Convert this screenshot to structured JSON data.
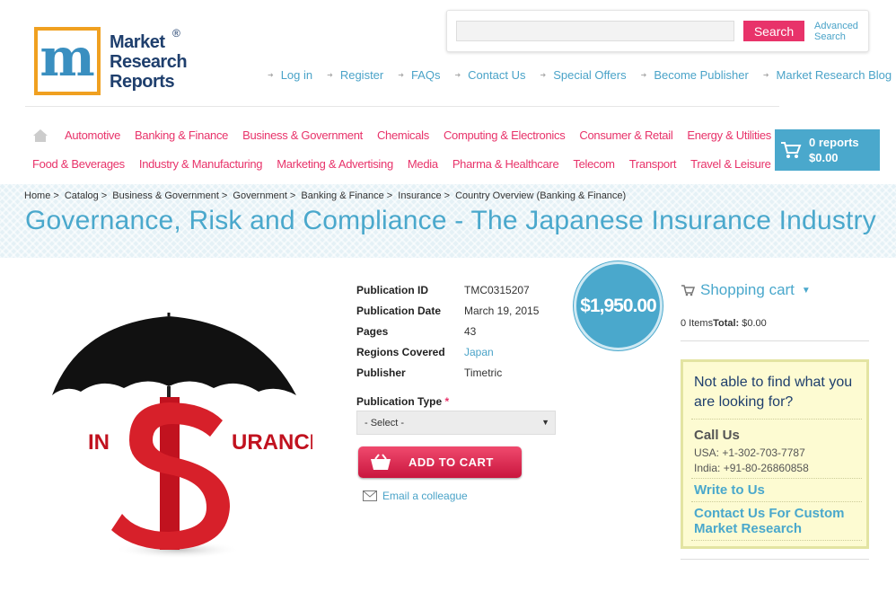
{
  "logo": {
    "letter": "m",
    "line1": "Market",
    "line2": "Research",
    "line3": "Reports",
    "reg": "®"
  },
  "search": {
    "placeholder": "",
    "button": "Search",
    "advanced_line1": "Advanced",
    "advanced_line2": "Search"
  },
  "top_links": [
    "Log in",
    "Register",
    "FAQs",
    "Contact Us",
    "Special Offers",
    "Become Publisher",
    "Market Research Blog"
  ],
  "categories_row1": [
    "Automotive",
    "Banking & Finance",
    "Business & Government",
    "Chemicals",
    "Computing & Electronics",
    "Consumer & Retail",
    "Energy & Utilities"
  ],
  "categories_row2": [
    "Food & Beverages",
    "Industry & Manufacturing",
    "Marketing & Advertising",
    "Media",
    "Pharma & Healthcare",
    "Telecom",
    "Transport",
    "Travel & Leisure"
  ],
  "cart": {
    "reports": "0 reports",
    "total": "$0.00"
  },
  "breadcrumb": [
    "Home",
    "Catalog",
    "Business & Government",
    "Government",
    "Banking & Finance",
    "Insurance",
    "Country Overview (Banking & Finance)"
  ],
  "page_title": "Governance, Risk and Compliance - The Japanese Insurance Industry",
  "product_image": {
    "left_text": "IN",
    "dollar": "$",
    "right_text": "URANCE"
  },
  "details": {
    "pub_id_label": "Publication ID",
    "pub_id": "TMC0315207",
    "pub_date_label": "Publication Date",
    "pub_date": "March 19, 2015",
    "pages_label": "Pages",
    "pages": "43",
    "regions_label": "Regions Covered",
    "regions": "Japan",
    "publisher_label": "Publisher",
    "publisher": "Timetric"
  },
  "publication_type": {
    "label": "Publication Type",
    "required": "*",
    "selected": "- Select -"
  },
  "add_to_cart": "ADD TO CART",
  "email_colleague": "Email a colleague",
  "price": "$1,950.00",
  "shopping_cart": {
    "title": "Shopping cart",
    "items": "0 Items",
    "total_label": "Total:",
    "total": "$0.00"
  },
  "help": {
    "title": "Not able to find what you are looking for?",
    "call_us": "Call Us",
    "usa": "USA: +1-302-703-7787",
    "india": "India: +91-80-26860858",
    "write": "Write to Us",
    "custom": "Contact Us For Custom Market Research"
  },
  "colors": {
    "accent_pink": "#e8336a",
    "accent_blue": "#4aa8cc",
    "logo_orange": "#f0a020",
    "help_bg": "#fdfbd2"
  }
}
